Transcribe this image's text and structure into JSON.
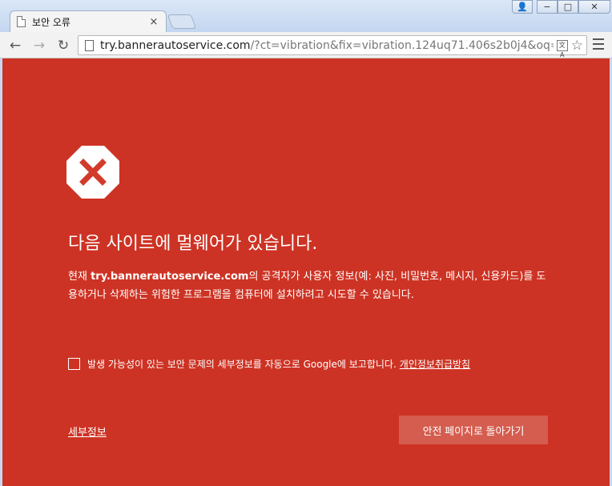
{
  "window": {
    "tab_title": "보안 오류",
    "tab_close": "×",
    "controls": {
      "user": "👤",
      "min": "−",
      "max": "□",
      "close": "✕"
    }
  },
  "toolbar": {
    "back": "←",
    "forward": "→",
    "reload": "↻",
    "url_host": "try.bannerautoservice.com",
    "url_rest": "/?ct=vibration&fix=vibration.124uq71.406s2b0j4&oq=",
    "translate_icon": "文A",
    "star": "☆"
  },
  "interstitial": {
    "headline": "다음 사이트에 멀웨어가 있습니다.",
    "explain_prefix": "현재 ",
    "explain_host": "try.bannerautoservice.com",
    "explain_suffix": "의 공격자가 사용자 정보(예: 사진, 비밀번호, 메시지, 신용카드)를 도용하거나 삭제하는 위험한 프로그램을 컴퓨터에 설치하려고 시도할 수 있습니다.",
    "report_text": "발생 가능성이 있는 보안 문제의 세부정보를 자동으로 Google에 보고합니다.",
    "policy_link": "개인정보취급방침",
    "details_link": "세부정보",
    "back_button": "안전 페이지로 돌아가기"
  },
  "colors": {
    "background": "#cd3324",
    "button": "#d55d4f"
  }
}
